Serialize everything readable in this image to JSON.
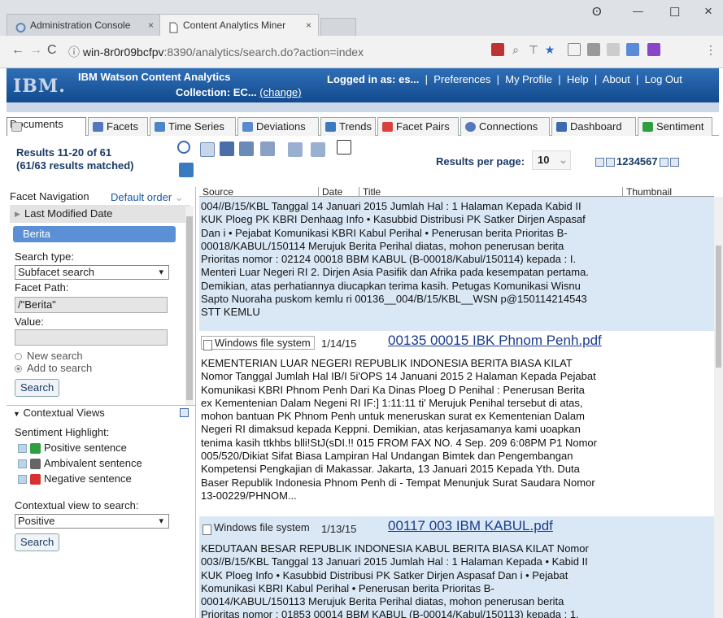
{
  "browser": {
    "tabs": [
      {
        "label": "Administration Console",
        "close": "×"
      },
      {
        "label": "Content Analytics Miner",
        "close": "×"
      }
    ],
    "window_controls": {
      "account": "ʘ",
      "minimize": "—",
      "maximize": "☐",
      "close": "×"
    },
    "url_host": "win-8r0r09bcfpv",
    "url_rest": ":8390/analytics/search.do?action=index",
    "nav": {
      "back": "←",
      "forward": "→",
      "reload": "C",
      "info": "ⓘ"
    }
  },
  "header": {
    "logo": "IBM.",
    "product": "IBM Watson Content Analytics",
    "collection_label": "Collection: EC...",
    "collection_change": "(change)",
    "logged_in": "Logged in as: es...",
    "sep": "|",
    "links": [
      "Preferences",
      "My Profile",
      "Help",
      "About",
      "Log Out"
    ]
  },
  "tabs": [
    {
      "label": "Documents",
      "icon_color": "#cccccc"
    },
    {
      "label": "Facets",
      "icon_color": "#5577bb"
    },
    {
      "label": "Time Series",
      "icon_color": "#4a86c8"
    },
    {
      "label": "Deviations",
      "icon_color": "#5a8ad0"
    },
    {
      "label": "Trends",
      "icon_color": "#3a7ac0"
    },
    {
      "label": "Facet Pairs",
      "icon_color": "#d84040"
    },
    {
      "label": "Connections",
      "icon_color": "#5577bb"
    },
    {
      "label": "Dashboard",
      "icon_color": "#3a6ab0"
    },
    {
      "label": "Sentiment",
      "icon_color": "#2e9e3e"
    }
  ],
  "results": {
    "title_line1": "Results 11-20 of 61",
    "title_line2": "(61/63 results matched)",
    "per_page_label": "Results per page:",
    "per_page_value": "10",
    "per_page_caret": "⌄",
    "pages": "1234567"
  },
  "facet_nav": {
    "label": "Facet Navigation",
    "order": "Default order",
    "order_caret": "⌄",
    "last_modified": "Last Modified Date",
    "selected": "Berita",
    "search_type_label": "Search type:",
    "search_type": "Subfacet search",
    "facet_path_label": "Facet Path:",
    "facet_path": "/\"Berita\"",
    "value_label": "Value:",
    "new_search": "New search",
    "add_to_search": "Add to search",
    "search_btn": "Search",
    "caret": "▾"
  },
  "contextual": {
    "label": "Contextual Views",
    "highlight_label": "Sentiment Highlight:",
    "items": [
      {
        "label": "Positive sentence",
        "color": "#2e9e3e"
      },
      {
        "label": "Ambivalent sentence",
        "color": "#666666"
      },
      {
        "label": "Negative sentence",
        "color": "#d83030"
      }
    ],
    "view_label": "Contextual view to search:",
    "view_value": "Positive",
    "search_btn": "Search"
  },
  "columns": [
    "Source",
    "Date",
    "Title",
    "Thumbnail"
  ],
  "entries": [
    {
      "source": "",
      "date": "",
      "title": "",
      "lines": [
        "004//B/15/KBL Tanggal 14 Januari 2015 Jumlah Hal : 1 Halaman Kepada Kabid II",
        "KUK Ploeg PK KBRI Denhaag Info • Kasubbid Distribusi PK Satker Dirjen Aspasaf",
        "Dan i • Pejabat Komunikasi KBRI Kabul Perihal • Penerusan berita Prioritas B-",
        "00018/KABUL/150114 Merujuk Berita Perihal diatas, mohon penerusan berita",
        "Prioritas nomor : 02124 00018 BBM KABUL (B-00018/Kabul/150114) kepada : I.",
        "Menteri Luar Negeri RI 2. Dirjen Asia Pasifik dan Afrika pada kesempatan pertama.",
        "Demikian, atas perhatiannya diucapkan terima kasih. Petugas Komunikasi Wisnu",
        "Sapto Nuoraha puskom kemlu ri 00136__004/B/15/KBL__WSN p@150114214543",
        "STT KEMLU"
      ]
    },
    {
      "source": "Windows file system",
      "date": "1/14/15",
      "title": "00135 00015 IBK Phnom Penh.pdf",
      "lines": [
        "KEMENTERIAN LUAR NEGERI REPUBLIK INDONESIA BERITA BIASA KILAT",
        "Nomor Tanggal Jumlah Hal IB/I 5i'OPS 14 Januani 2015 2 Halaman Kepada Pejabat",
        "Komunikasi KBRI Phnom Penh Dari Ka Dinas Ploeg D Penihal : Penerusan Berita",
        "ex Kementenian Dalam Negeni RI IF:] 1:11:11 ti' Merujuk Penihal tersebut di atas,",
        "mohon bantuan PK Phnom Penh untuk meneruskan surat ex Kementenian Dalam",
        "Negeri RI dimaksud kepada Keppni. Demikian, atas kerjasamanya kami uoapkan",
        "tenima kasih ttkhbs blli!StJ(sDI.!! 015 FROM FAX NO. 4 Sep. 209 6:08PM P1 Nomor",
        "005/520/Dikiat Sifat Biasa Lampiran Hal Undangan Bimtek dan Pengembangan",
        "Kompetensi Pengkajian di Makassar. Jakarta, 13 Januari 2015 Kepada Yth. Duta",
        "Baser Republik Indonesia Phnom Penh di - Tempat Menunjuk Surat Saudara Nomor",
        "13-00229/PHNOM..."
      ]
    },
    {
      "source": "Windows file system",
      "date": "1/13/15",
      "title": "00117 003 IBM KABUL.pdf",
      "lines": [
        "KEDUTAAN BESAR REPUBLIK INDONESIA KABUL BERITA BIASA KILAT Nomor",
        "003//B/15/KBL Tanggal 13 Januari 2015 Jumlah Hal : 1 Halaman Kepada • Kabid II",
        "KUK Ploeg Info • Kasubbid Distribusi PK Satker Dirjen Aspasaf Dan i • Pejabat",
        "Komunikasi KBRI Kabul Perihal • Penerusan berita Prioritas B-",
        "00014/KABUL/150113 Merujuk Berita Perihal diatas, mohon penerusan berita",
        "Prioritas nomor : 01853 00014 BBM KABUL (B-00014/Kabul/150113) kepada : 1."
      ]
    }
  ]
}
